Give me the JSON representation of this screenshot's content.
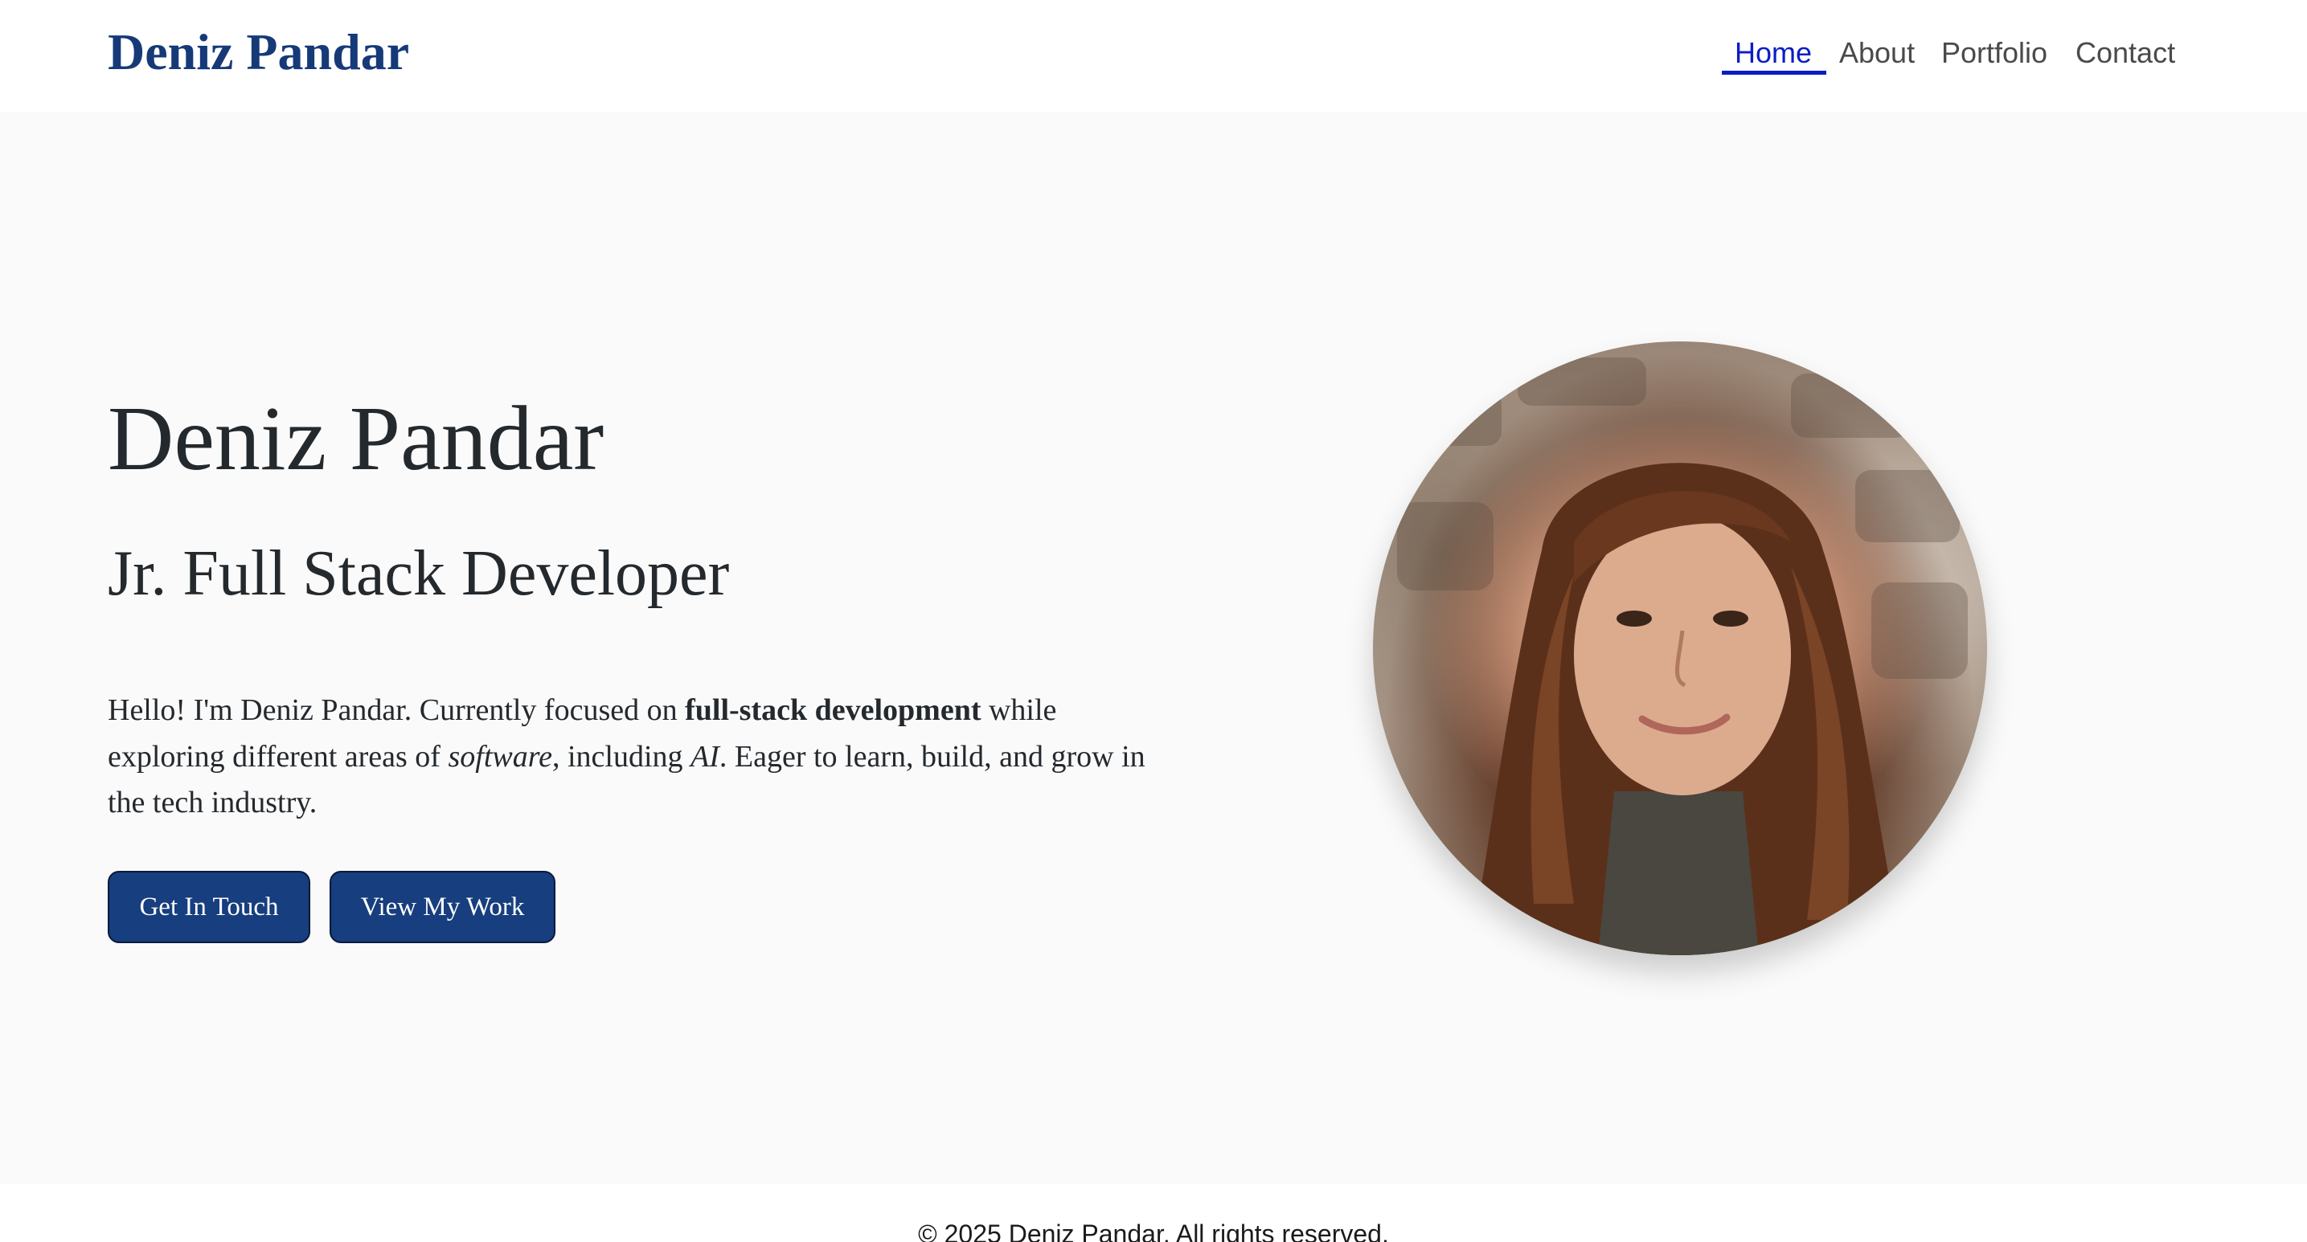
{
  "header": {
    "brand": "Deniz Pandar",
    "nav": [
      {
        "label": "Home",
        "active": true
      },
      {
        "label": "About",
        "active": false
      },
      {
        "label": "Portfolio",
        "active": false
      },
      {
        "label": "Contact",
        "active": false
      }
    ]
  },
  "hero": {
    "name": "Deniz Pandar",
    "role": "Jr. Full Stack Developer",
    "intro": {
      "part1": "Hello! I'm Deniz Pandar. Currently focused on ",
      "bold": "full-stack development",
      "part2": " while exploring different areas of ",
      "italic1": "software",
      "part3": ", including ",
      "italic2": "AI",
      "part4": ". Eager to learn, build, and grow in the tech industry."
    },
    "buttons": {
      "primary": "Get In Touch",
      "secondary": "View My Work"
    }
  },
  "footer": {
    "copyright": "© 2025 Deniz Pandar. All rights reserved."
  },
  "colors": {
    "brand": "#163a78",
    "button": "#173e7e",
    "nav_active": "#0b1dc2",
    "hero_bg": "#fafafa"
  }
}
